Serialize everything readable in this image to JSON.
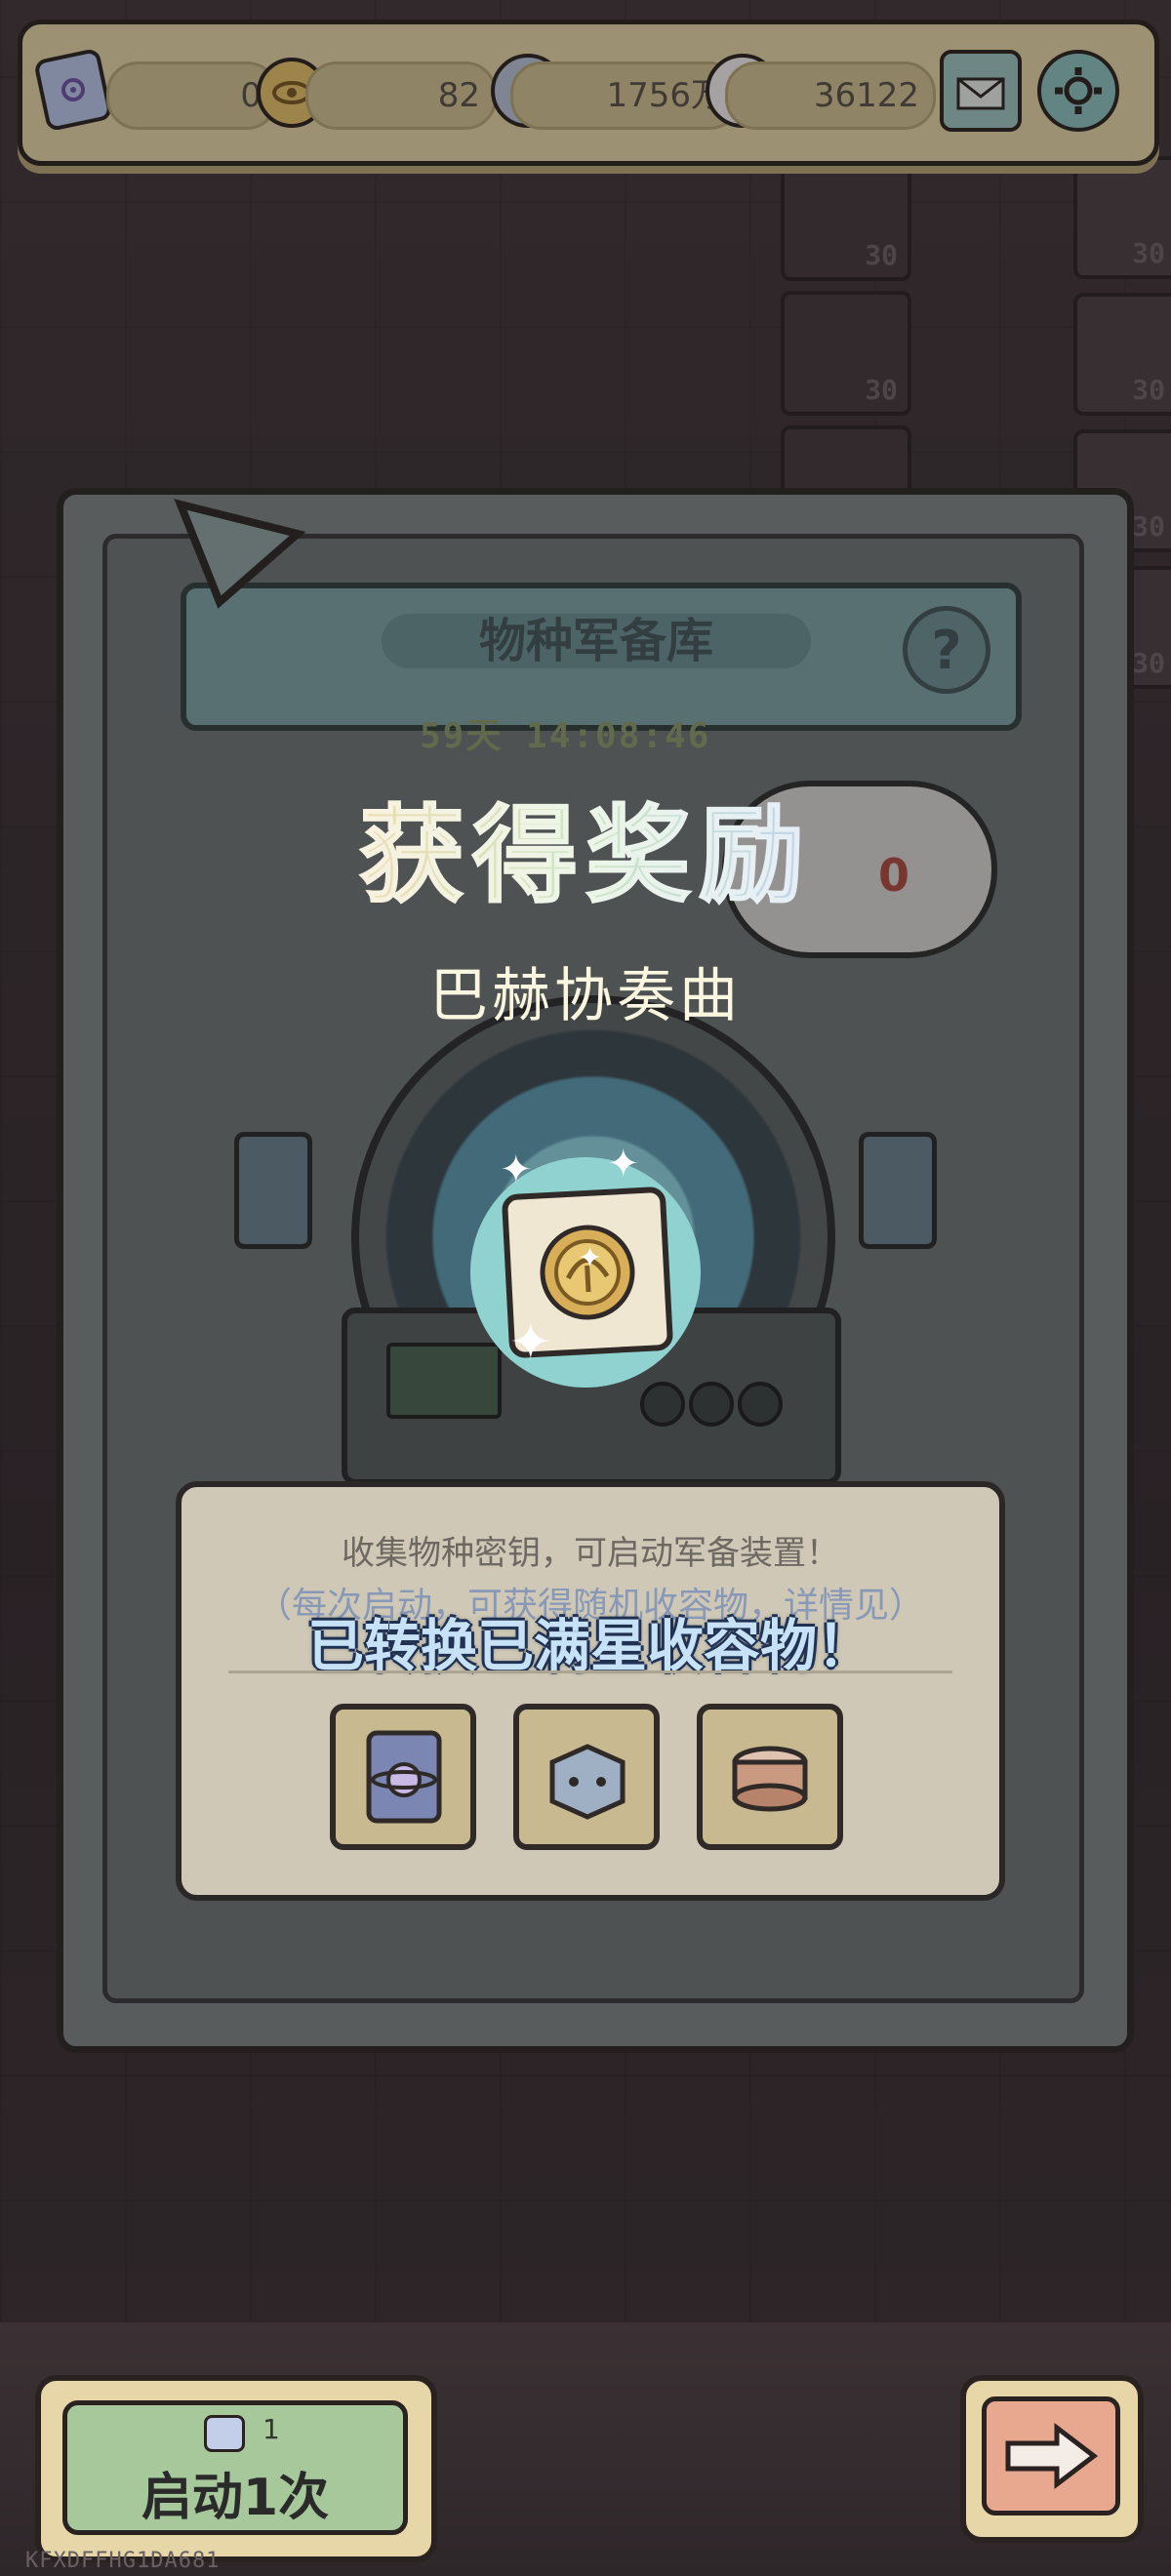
{
  "top_bar": {
    "key_count": "0",
    "eye_coin_count": "82",
    "blue_shell_count": "1756万",
    "pink_shell_count": "36122"
  },
  "panel": {
    "title": "物种军备库",
    "help_symbol": "?",
    "countdown": "59天 14:08:46",
    "red_counter": "0"
  },
  "reward": {
    "heading": "获得奖励",
    "item_name": "巴赫协奏曲"
  },
  "dialog": {
    "description": "收集物种密钥，可启动军备装置！",
    "sub_note": "（每次启动，可获得随机收容物，详情见）",
    "notice": "已转换已满星收容物！"
  },
  "start_button": {
    "cost": "1",
    "label": "启动1次"
  },
  "background_counters": [
    "30",
    "30",
    "30",
    "30",
    "30",
    "30",
    "30"
  ],
  "watermark": "KFXDFFHG1DA681",
  "colors": {
    "bar_bg": "#e6d6a8",
    "start_btn": "#a7c89b",
    "next_btn": "#e8a88f",
    "notice_text": "#c7e1f6",
    "reward_circle": "#8fd2cf"
  }
}
